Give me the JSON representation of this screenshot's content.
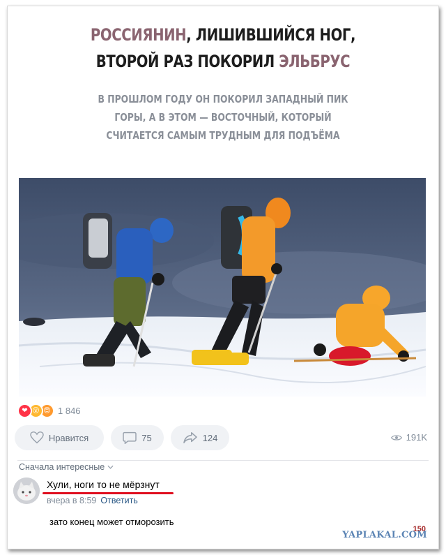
{
  "headline": {
    "line1_accent": "РОССИЯНИН",
    "line1_rest": ", ЛИШИВШИЙСЯ НОГ,",
    "line2_rest": "ВТОРОЙ РАЗ ПОКОРИЛ ",
    "line2_accent": "ЭЛЬБРУС"
  },
  "subhead": {
    "line1": "В ПРОШЛОМ ГОДУ ОН ПОКОРИЛ ЗАПАДНЫЙ ПИК",
    "line2": "ГОРЫ, А В ЭТОМ — ВОСТОЧНЫЙ, КОТОРЫЙ",
    "line3": "СЧИТАЕТСЯ САМЫМ ТРУДНЫМ ДЛЯ ПОДЪЁМА"
  },
  "reactions": {
    "icons": [
      "heart-reaction-icon",
      "wow-reaction-icon",
      "heart-eyes-reaction-icon"
    ],
    "count": "1 846"
  },
  "actions": {
    "like_label": "Нравится",
    "comments_count": "75",
    "shares_count": "124",
    "views_count": "191K"
  },
  "comments": {
    "sort_label": "Сначала интересные",
    "items": [
      {
        "text": "Хули, ноги то не мёрзнут",
        "time": "вчера в 8:59",
        "reply_label": "Ответить"
      }
    ]
  },
  "caption": "зато конец может отморозить",
  "watermark": "YAPLAKAL.COM",
  "bottom_badge": "150",
  "colors": {
    "accent_title": "#8a6470",
    "link": "#2a5885",
    "underline": "#e01020",
    "button_bg": "#f0f2f5"
  }
}
